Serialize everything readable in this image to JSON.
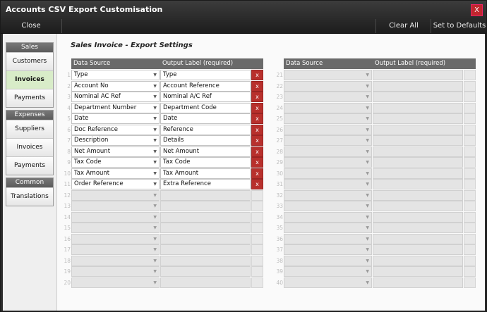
{
  "window": {
    "title": "Accounts CSV Export Customisation",
    "close_glyph": "X"
  },
  "toolbar": {
    "close_label": "Close",
    "clear_all_label": "Clear All",
    "set_defaults_label": "Set to Defaults"
  },
  "sidebar": {
    "groups": [
      {
        "header": "Sales",
        "items": [
          {
            "label": "Customers"
          },
          {
            "label": "Invoices"
          },
          {
            "label": "Payments"
          }
        ]
      },
      {
        "header": "Expenses",
        "items": [
          {
            "label": "Suppliers"
          },
          {
            "label": "Invoices"
          },
          {
            "label": "Payments"
          }
        ]
      },
      {
        "header": "Common",
        "items": [
          {
            "label": "Translations"
          }
        ]
      }
    ],
    "active": "Sales / Invoices"
  },
  "section_title": "Sales Invoice - Export Settings",
  "columns": {
    "data_source": "Data Source",
    "output_label": "Output Label (required)"
  },
  "delete_glyph": "x",
  "dropdown_glyph": "▼",
  "left_rows": [
    {
      "num": "1",
      "source": "Type",
      "label": "Type"
    },
    {
      "num": "2",
      "source": "Account No",
      "label": "Account Reference"
    },
    {
      "num": "3",
      "source": "Nominal AC Ref",
      "label": "Nominal A/C Ref"
    },
    {
      "num": "4",
      "source": "Department Number",
      "label": "Department Code"
    },
    {
      "num": "5",
      "source": "Date",
      "label": "Date"
    },
    {
      "num": "6",
      "source": "Doc Reference",
      "label": "Reference"
    },
    {
      "num": "7",
      "source": "Description",
      "label": "Details"
    },
    {
      "num": "8",
      "source": "Net Amount",
      "label": "Net Amount"
    },
    {
      "num": "9",
      "source": "Tax Code",
      "label": "Tax Code"
    },
    {
      "num": "10",
      "source": "Tax Amount",
      "label": "Tax Amount"
    },
    {
      "num": "11",
      "source": "Order Reference",
      "label": "Extra Reference"
    },
    {
      "num": "12",
      "source": "",
      "label": ""
    },
    {
      "num": "13",
      "source": "",
      "label": ""
    },
    {
      "num": "14",
      "source": "",
      "label": ""
    },
    {
      "num": "15",
      "source": "",
      "label": ""
    },
    {
      "num": "16",
      "source": "",
      "label": ""
    },
    {
      "num": "17",
      "source": "",
      "label": ""
    },
    {
      "num": "18",
      "source": "",
      "label": ""
    },
    {
      "num": "19",
      "source": "",
      "label": ""
    },
    {
      "num": "20",
      "source": "",
      "label": ""
    }
  ],
  "right_rows": [
    {
      "num": "21",
      "source": "",
      "label": ""
    },
    {
      "num": "22",
      "source": "",
      "label": ""
    },
    {
      "num": "23",
      "source": "",
      "label": ""
    },
    {
      "num": "24",
      "source": "",
      "label": ""
    },
    {
      "num": "25",
      "source": "",
      "label": ""
    },
    {
      "num": "26",
      "source": "",
      "label": ""
    },
    {
      "num": "27",
      "source": "",
      "label": ""
    },
    {
      "num": "28",
      "source": "",
      "label": ""
    },
    {
      "num": "29",
      "source": "",
      "label": ""
    },
    {
      "num": "30",
      "source": "",
      "label": ""
    },
    {
      "num": "31",
      "source": "",
      "label": ""
    },
    {
      "num": "32",
      "source": "",
      "label": ""
    },
    {
      "num": "33",
      "source": "",
      "label": ""
    },
    {
      "num": "34",
      "source": "",
      "label": ""
    },
    {
      "num": "35",
      "source": "",
      "label": ""
    },
    {
      "num": "36",
      "source": "",
      "label": ""
    },
    {
      "num": "37",
      "source": "",
      "label": ""
    },
    {
      "num": "38",
      "source": "",
      "label": ""
    },
    {
      "num": "39",
      "source": "",
      "label": ""
    },
    {
      "num": "40",
      "source": "",
      "label": ""
    }
  ]
}
